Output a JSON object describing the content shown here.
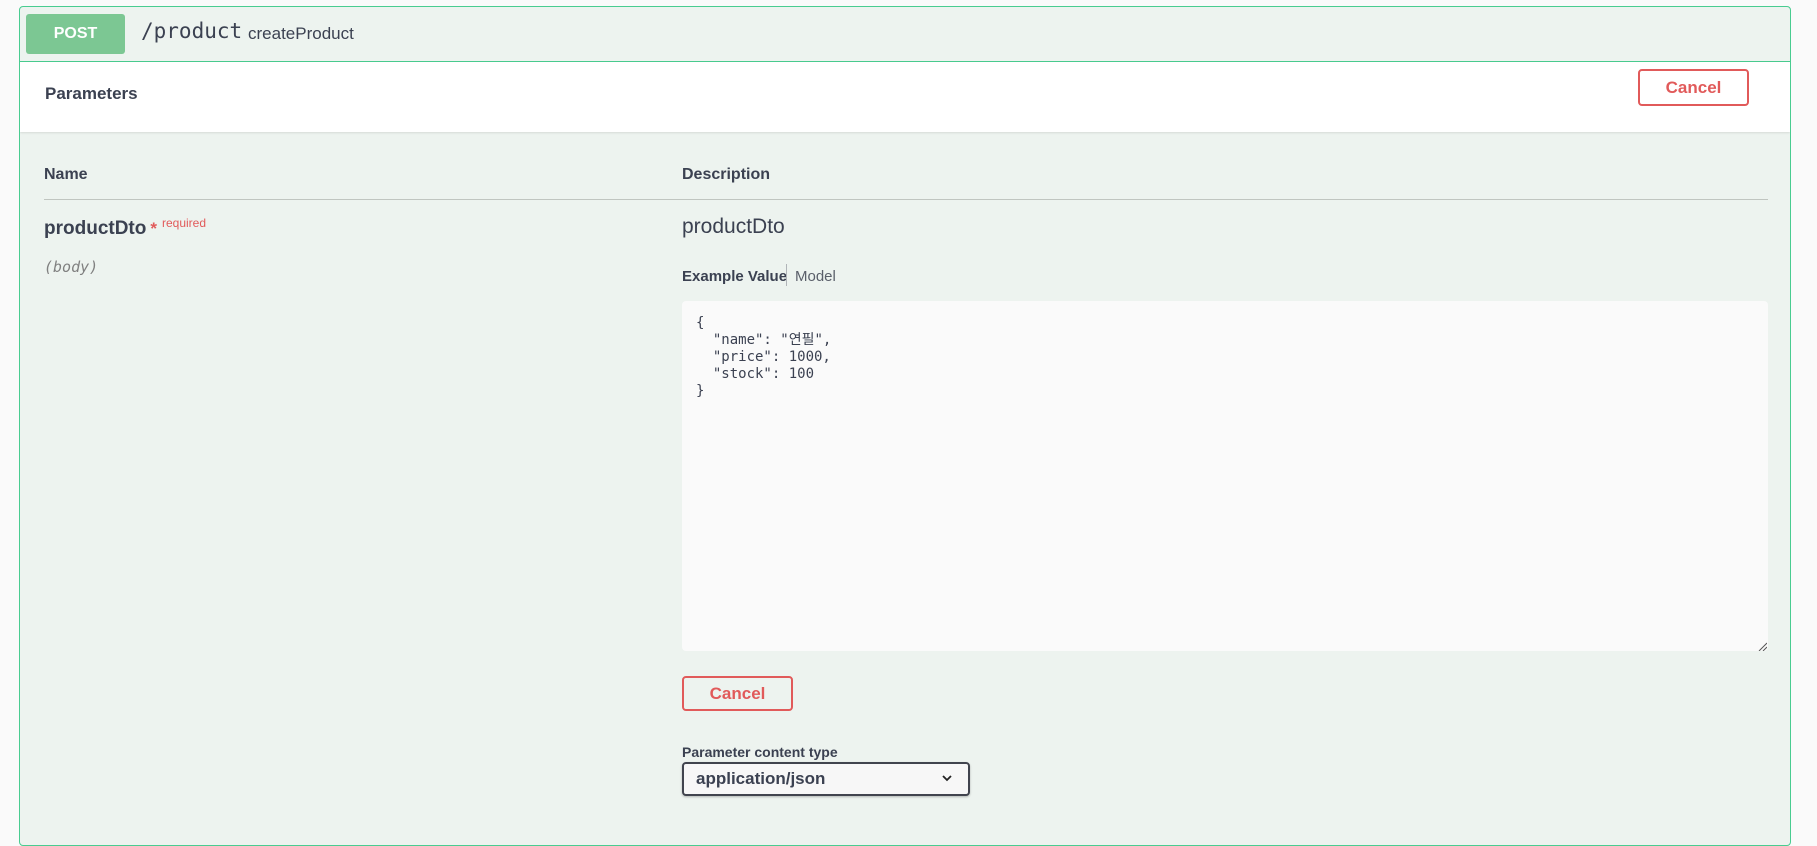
{
  "operation": {
    "method": "POST",
    "path": "/product",
    "operation_id": "createProduct"
  },
  "parameters_section": {
    "title": "Parameters",
    "cancel_label": "Cancel"
  },
  "table": {
    "name_header": "Name",
    "description_header": "Description"
  },
  "param": {
    "name": "productDto",
    "required_star": "*",
    "required_label": "required",
    "in": "(body)",
    "description": "productDto"
  },
  "tabs": {
    "example_value": "Example Value",
    "model": "Model"
  },
  "body_value": "{\n  \"name\": \"연필\",\n  \"price\": 1000,\n  \"stock\": 100\n}",
  "bottom_cancel_label": "Cancel",
  "content_type": {
    "label": "Parameter content type",
    "selected": "application/json"
  },
  "colors": {
    "post_green": "#49cc90",
    "method_badge": "#7cc793",
    "cancel_red": "#e15a5a"
  }
}
